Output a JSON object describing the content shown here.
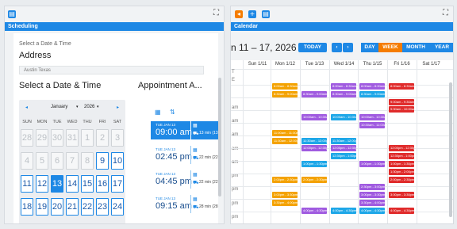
{
  "scheduling": {
    "header": "Scheduling",
    "select_prompt": "Select a Date & Time",
    "address_heading": "Address",
    "address_value": "Austin Texas",
    "select_heading": "Select a Date & Time",
    "appointments_heading": "Appointment A...",
    "calendar": {
      "prev": "◂",
      "next": "▸",
      "month": "January",
      "year": "2026",
      "day_headers": [
        "SUN",
        "MON",
        "TUE",
        "WED",
        "THU",
        "FRI",
        "SAT"
      ],
      "days": [
        "28",
        "29",
        "30",
        "31",
        "1",
        "2",
        "3",
        "4",
        "5",
        "6",
        "7",
        "8",
        "9",
        "10",
        "11",
        "12",
        "13",
        "14",
        "15",
        "16",
        "17",
        "18",
        "19",
        "20",
        "21",
        "22",
        "23",
        "24"
      ],
      "selected_day": "13"
    },
    "appointments": [
      {
        "date": "TUE JAN 13",
        "time": "09:00 am",
        "duration": "13 min (13 mi)"
      },
      {
        "date": "TUE JAN 13",
        "time": "02:45 pm",
        "duration": "22 min (22 mi)"
      },
      {
        "date": "TUE JAN 13",
        "time": "04:45 pm",
        "duration": "22 min (22 mi)"
      },
      {
        "date": "TUE JAN 13",
        "time": "09:15 am",
        "duration": "28 min (28 mi)"
      }
    ]
  },
  "calendar": {
    "header": "Calendar",
    "title": "n 11 – 17, 2026",
    "today_label": "TODAY",
    "prev": "‹",
    "next": "›",
    "views": [
      "DAY",
      "WEEK",
      "MONTH",
      "YEAR"
    ],
    "active_view": "WEEK",
    "columns": [
      "Sun 1/11",
      "Mon 1/12",
      "Tue 1/13",
      "Wed 1/14",
      "Thu 1/15",
      "Fri 1/16",
      "Sat 1/17"
    ],
    "time_labels": [
      "T",
      "E",
      "am",
      "am",
      "am",
      "am",
      "am",
      "pm",
      "pm",
      "pm",
      "pm"
    ],
    "colors": {
      "orange": "#f4a200",
      "purple": "#a05be0",
      "blue": "#1ea7e8",
      "red": "#e02b2b",
      "accent": "#1e88e5",
      "active": "#f57c00"
    },
    "events": [
      {
        "col": 1,
        "row": 0,
        "label": "8:00am - 8:30am",
        "color": "orange"
      },
      {
        "col": 1,
        "row": 1,
        "label": "8:30am - 9:00am",
        "color": "orange"
      },
      {
        "col": 2,
        "row": 1,
        "label": "8:30am - 9:00am",
        "color": "purple"
      },
      {
        "col": 3,
        "row": 0,
        "label": "8:00am - 8:30am",
        "color": "purple"
      },
      {
        "col": 3,
        "row": 1,
        "label": "8:30am - 9:00am",
        "color": "purple"
      },
      {
        "col": 4,
        "row": 0,
        "label": "8:00am - 8:30am",
        "color": "purple"
      },
      {
        "col": 4,
        "row": 1,
        "label": "8:30am - 9:00am",
        "color": "blue"
      },
      {
        "col": 5,
        "row": 0,
        "label": "8:00am - 8:30am",
        "color": "red"
      },
      {
        "col": 5,
        "row": 2,
        "label": "9:00am - 9:30am",
        "color": "red"
      },
      {
        "col": 5,
        "row": 3,
        "label": "9:30am - 10:00am",
        "color": "red"
      },
      {
        "col": 2,
        "row": 4,
        "label": "10:00am - 10:30am",
        "color": "purple"
      },
      {
        "col": 3,
        "row": 4,
        "label": "10:00am - 10:30am",
        "color": "blue"
      },
      {
        "col": 4,
        "row": 4,
        "label": "10:00am - 10:30am",
        "color": "purple"
      },
      {
        "col": 4,
        "row": 5,
        "label": "10:30am - 11:00am",
        "color": "purple"
      },
      {
        "col": 1,
        "row": 6,
        "label": "11:00am - 11:30am",
        "color": "orange"
      },
      {
        "col": 1,
        "row": 7,
        "label": "11:30am - 12:00pm",
        "color": "orange"
      },
      {
        "col": 2,
        "row": 7,
        "label": "11:30am - 12:00pm",
        "color": "blue"
      },
      {
        "col": 3,
        "row": 7,
        "label": "11:30am - 12:00pm",
        "color": "blue"
      },
      {
        "col": 2,
        "row": 8,
        "label": "12:00pm - 12:30pm",
        "color": "purple"
      },
      {
        "col": 3,
        "row": 8,
        "label": "12:00pm - 12:30pm",
        "color": "purple"
      },
      {
        "col": 5,
        "row": 8,
        "label": "12:00pm - 12:30pm",
        "color": "red"
      },
      {
        "col": 3,
        "row": 9,
        "label": "12:30pm - 1:00pm",
        "color": "blue"
      },
      {
        "col": 5,
        "row": 9,
        "label": "12:30pm - 1:00pm",
        "color": "red"
      },
      {
        "col": 2,
        "row": 10,
        "label": "1:00pm - 1:30pm",
        "color": "blue"
      },
      {
        "col": 4,
        "row": 10,
        "label": "1:00pm - 1:30pm",
        "color": "purple"
      },
      {
        "col": 5,
        "row": 10,
        "label": "1:00pm - 1:30pm",
        "color": "red"
      },
      {
        "col": 5,
        "row": 11,
        "label": "1:30pm - 2:00pm",
        "color": "red"
      },
      {
        "col": 1,
        "row": 12,
        "label": "2:00pm - 2:30pm",
        "color": "orange"
      },
      {
        "col": 2,
        "row": 12,
        "label": "2:00pm - 2:30pm",
        "color": "orange"
      },
      {
        "col": 5,
        "row": 12,
        "label": "2:00pm - 2:30pm",
        "color": "red"
      },
      {
        "col": 4,
        "row": 13,
        "label": "2:30pm - 3:00pm",
        "color": "purple"
      },
      {
        "col": 1,
        "row": 14,
        "label": "3:00pm - 3:30pm",
        "color": "orange"
      },
      {
        "col": 4,
        "row": 14,
        "label": "3:00pm - 3:30pm",
        "color": "purple"
      },
      {
        "col": 5,
        "row": 14,
        "label": "3:00pm - 3:30pm",
        "color": "red"
      },
      {
        "col": 1,
        "row": 15,
        "label": "3:30pm - 4:00pm",
        "color": "orange"
      },
      {
        "col": 4,
        "row": 15,
        "label": "3:30pm - 4:00pm",
        "color": "purple"
      },
      {
        "col": 2,
        "row": 16,
        "label": "4:00pm - 4:30pm",
        "color": "purple"
      },
      {
        "col": 3,
        "row": 16,
        "label": "4:00pm - 4:30pm",
        "color": "blue"
      },
      {
        "col": 4,
        "row": 16,
        "label": "4:00pm - 4:30pm",
        "color": "blue"
      },
      {
        "col": 5,
        "row": 16,
        "label": "4:00pm - 4:30pm",
        "color": "red"
      }
    ]
  }
}
